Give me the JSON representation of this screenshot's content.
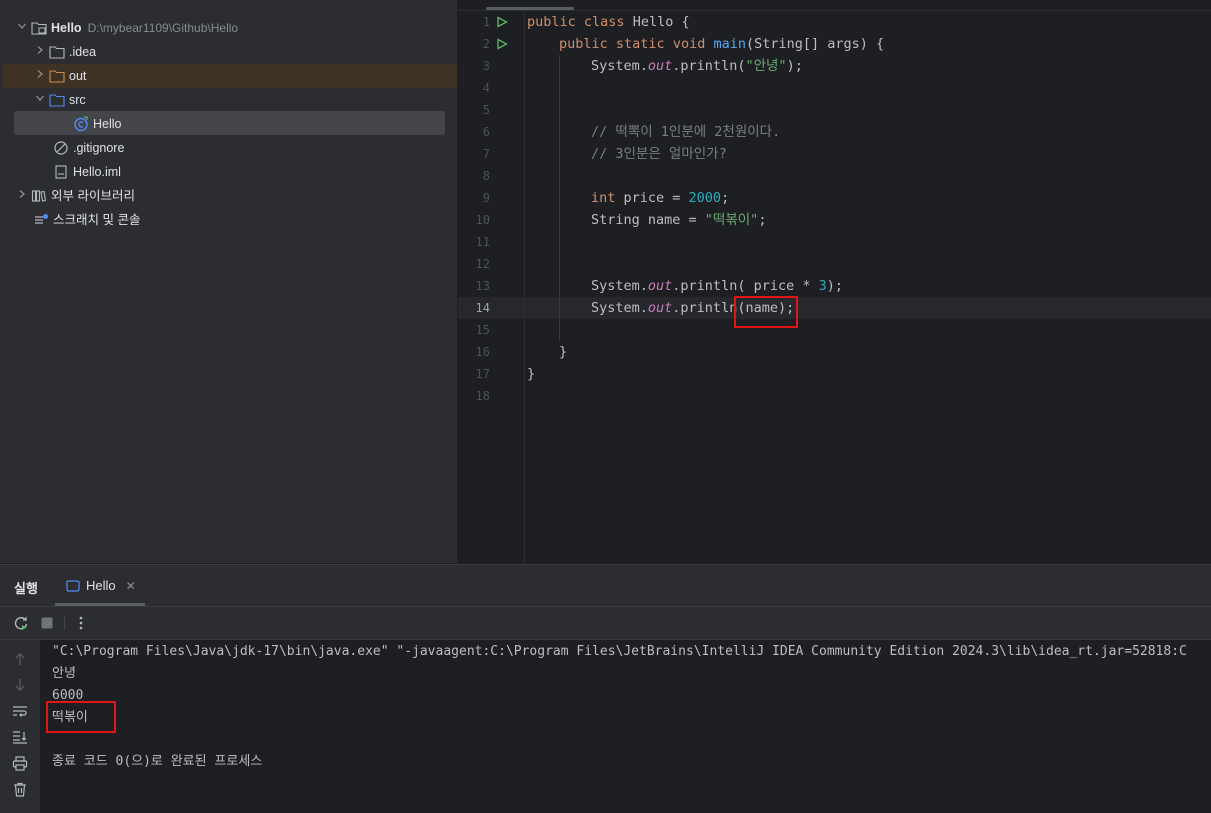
{
  "project_tree": {
    "root": {
      "name": "Hello",
      "path": "D:\\mybear1109\\Github\\Hello"
    },
    "items": [
      {
        "label": ".idea"
      },
      {
        "label": "out"
      },
      {
        "label": "src"
      },
      {
        "label": "Hello"
      },
      {
        "label": ".gitignore"
      },
      {
        "label": "Hello.iml"
      },
      {
        "label": "외부 라이브러리"
      },
      {
        "label": "스크래치 및 콘솔"
      }
    ]
  },
  "editor": {
    "line_numbers": [
      "1",
      "2",
      "3",
      "4",
      "5",
      "6",
      "7",
      "8",
      "9",
      "10",
      "11",
      "12",
      "13",
      "14",
      "15",
      "16",
      "17",
      "18"
    ],
    "active_line": "14",
    "code": {
      "l1": {
        "kw1": "public",
        "kw2": "class",
        "rest": " Hello {"
      },
      "l2": {
        "kw1": "public",
        "kw2": "static",
        "kw3": "void",
        "fn": "main",
        "rest": "(String[] args) {"
      },
      "l3": {
        "a": "System.",
        "out": "out",
        "b": ".println(",
        "str": "\"안녕\"",
        "c": ");"
      },
      "l6": {
        "comment": "// 떡뽁이 1인분에 2천원이다."
      },
      "l7": {
        "comment": "// 3인분은 얼마인가?"
      },
      "l9": {
        "kw": "int",
        "a": " price = ",
        "num": "2000",
        "b": ";"
      },
      "l10": {
        "a": "String name = ",
        "str": "\"떡볶이\"",
        "b": ";"
      },
      "l13": {
        "a": "System.",
        "out": "out",
        "b": ".println( price * ",
        "num": "3",
        "c": ");"
      },
      "l14": {
        "a": "System.",
        "out": "out",
        "b": ".println(name);"
      },
      "l16": {
        "a": "}"
      },
      "l17": {
        "a": "}"
      }
    }
  },
  "run_panel": {
    "title": "실행",
    "tab_label": "Hello",
    "console": [
      "\"C:\\Program Files\\Java\\jdk-17\\bin\\java.exe\" \"-javaagent:C:\\Program Files\\JetBrains\\IntelliJ IDEA Community Edition 2024.3\\lib\\idea_rt.jar=52818:C",
      "안녕",
      "6000",
      "떡볶이",
      "",
      "종료 코드 0(으)로 완료된 프로세스"
    ]
  },
  "colors": {
    "accent_annotation": "#e01515",
    "keyword": "#cf8e6d",
    "string": "#6aab73",
    "number": "#2aacb8",
    "function": "#56a8f5",
    "static_field": "#c77dbb",
    "comment": "#7a7e85"
  },
  "icons": [
    "chevron-down-icon",
    "chevron-right-icon",
    "project-folder-icon",
    "folder-icon",
    "java-class-icon",
    "ignore-file-icon",
    "module-file-icon",
    "library-icon",
    "scratch-icon",
    "run-icon",
    "stop-icon",
    "more-icon",
    "rerun-icon",
    "scroll-up-icon",
    "scroll-down-icon",
    "soft-wrap-icon",
    "scroll-to-end-icon",
    "print-icon",
    "trash-icon",
    "close-icon"
  ]
}
